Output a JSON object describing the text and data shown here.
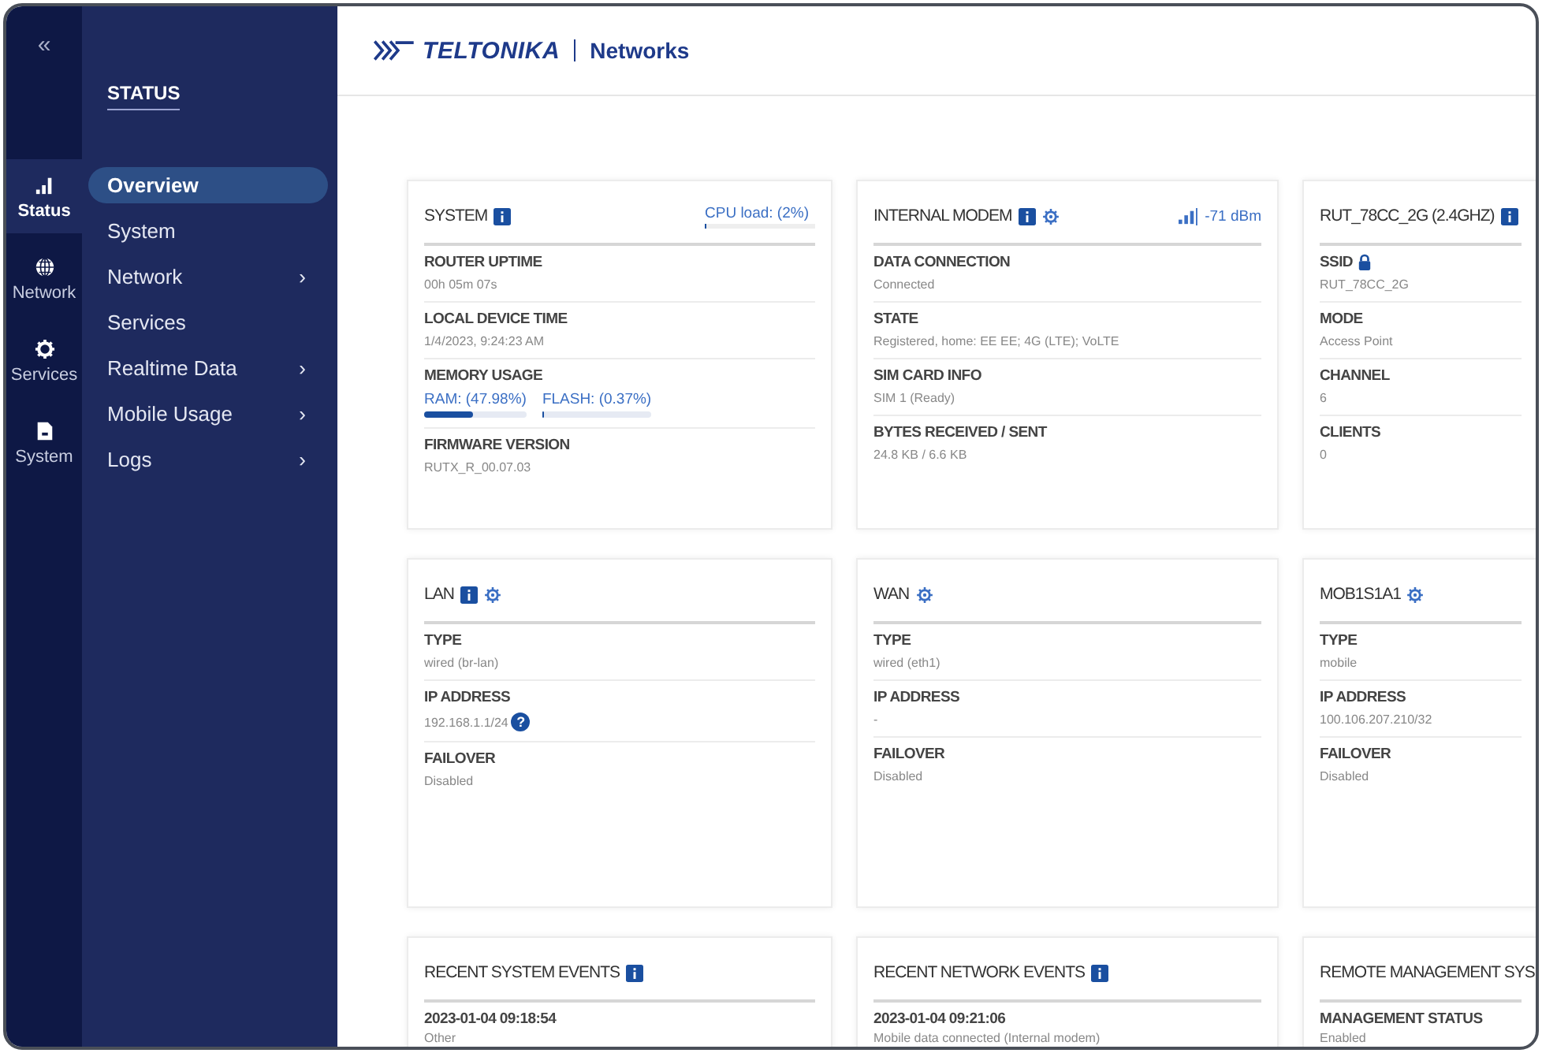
{
  "sidebar": {
    "collapse": "«",
    "rail": [
      {
        "kind": "signal",
        "label": "Status",
        "selected": true
      },
      {
        "kind": "globe",
        "label": "Network",
        "selected": false
      },
      {
        "kind": "gear",
        "label": "Services",
        "selected": false
      },
      {
        "kind": "file",
        "label": "System",
        "selected": false
      }
    ],
    "section_title": "STATUS",
    "menu": [
      {
        "label": "Overview",
        "selected": true,
        "has_submenu": false
      },
      {
        "label": "System",
        "selected": false,
        "has_submenu": false
      },
      {
        "label": "Network",
        "selected": false,
        "has_submenu": true
      },
      {
        "label": "Services",
        "selected": false,
        "has_submenu": false
      },
      {
        "label": "Realtime Data",
        "selected": false,
        "has_submenu": true
      },
      {
        "label": "Mobile Usage",
        "selected": false,
        "has_submenu": true
      },
      {
        "label": "Logs",
        "selected": false,
        "has_submenu": true
      }
    ],
    "submenu_caret": "›"
  },
  "header": {
    "logo": "TELTONIKA",
    "product": "Networks"
  },
  "cards": [
    {
      "title": "SYSTEM",
      "info": true,
      "gear": false,
      "extra": {
        "kind": "meter",
        "text": "CPU load: (2%)",
        "level": 0.02
      },
      "fields": [
        {
          "kind": "text",
          "label": "ROUTER UPTIME",
          "value": "00h 05m 07s"
        },
        {
          "kind": "text",
          "label": "LOCAL DEVICE TIME",
          "value": "1/4/2023, 9:24:23 AM"
        },
        {
          "kind": "meters",
          "label": "MEMORY USAGE",
          "meters": [
            {
              "text": "RAM: (47.98%)",
              "level": 0.48
            },
            {
              "text": "FLASH: (0.37%)",
              "level": 0.0037
            }
          ]
        },
        {
          "kind": "text",
          "label": "FIRMWARE VERSION",
          "value": "RUTX_R_00.07.03"
        }
      ]
    },
    {
      "title": "INTERNAL MODEM",
      "info": true,
      "gear": true,
      "extra": {
        "kind": "signal",
        "text": "-71 dBm"
      },
      "fields": [
        {
          "kind": "text",
          "label": "DATA CONNECTION",
          "value": "Connected"
        },
        {
          "kind": "text",
          "label": "STATE",
          "value": "Registered, home: EE EE; 4G (LTE); VoLTE"
        },
        {
          "kind": "text",
          "label": "SIM CARD INFO",
          "value": "SIM 1 (Ready)"
        },
        {
          "kind": "text",
          "label": "BYTES RECEIVED / SENT",
          "value": "24.8 KB / 6.6 KB"
        }
      ]
    },
    {
      "title": "RUT_78CC_2G (2.4GHZ)",
      "info": true,
      "gear": false,
      "fields": [
        {
          "kind": "text",
          "label": "SSID",
          "value": "RUT_78CC_2G",
          "lock": true
        },
        {
          "kind": "text",
          "label": "MODE",
          "value": "Access Point"
        },
        {
          "kind": "text",
          "label": "CHANNEL",
          "value": "6"
        },
        {
          "kind": "text",
          "label": "CLIENTS",
          "value": "0"
        }
      ]
    },
    {
      "title": "LAN",
      "info": true,
      "gear": true,
      "fields": [
        {
          "kind": "text",
          "label": "TYPE",
          "value": "wired (br-lan)"
        },
        {
          "kind": "text",
          "label": "IP ADDRESS",
          "value": "192.168.1.1/24",
          "help": "?"
        },
        {
          "kind": "text",
          "label": "FAILOVER",
          "value": "Disabled"
        }
      ]
    },
    {
      "title": "WAN",
      "info": false,
      "gear": true,
      "fields": [
        {
          "kind": "text",
          "label": "TYPE",
          "value": "wired (eth1)"
        },
        {
          "kind": "text",
          "label": "IP ADDRESS",
          "value": "-"
        },
        {
          "kind": "text",
          "label": "FAILOVER",
          "value": "Disabled"
        }
      ]
    },
    {
      "title": "MOB1S1A1",
      "info": false,
      "gear": true,
      "fields": [
        {
          "kind": "text",
          "label": "TYPE",
          "value": "mobile"
        },
        {
          "kind": "text",
          "label": "IP ADDRESS",
          "value": "100.106.207.210/32"
        },
        {
          "kind": "text",
          "label": "FAILOVER",
          "value": "Disabled"
        }
      ]
    },
    {
      "title": "RECENT SYSTEM EVENTS",
      "info": true,
      "gear": false,
      "fields": [
        {
          "kind": "text",
          "label": "2023-01-04 09:18:54",
          "value": "Other"
        }
      ]
    },
    {
      "title": "RECENT NETWORK EVENTS",
      "info": true,
      "gear": false,
      "fields": [
        {
          "kind": "text",
          "label": "2023-01-04 09:21:06",
          "value": "Mobile data connected (Internal modem)"
        }
      ]
    },
    {
      "title": "REMOTE MANAGEMENT SYS",
      "info": false,
      "gear": false,
      "fields": [
        {
          "kind": "text",
          "label": "MANAGEMENT STATUS",
          "value": "Enabled"
        }
      ]
    }
  ]
}
